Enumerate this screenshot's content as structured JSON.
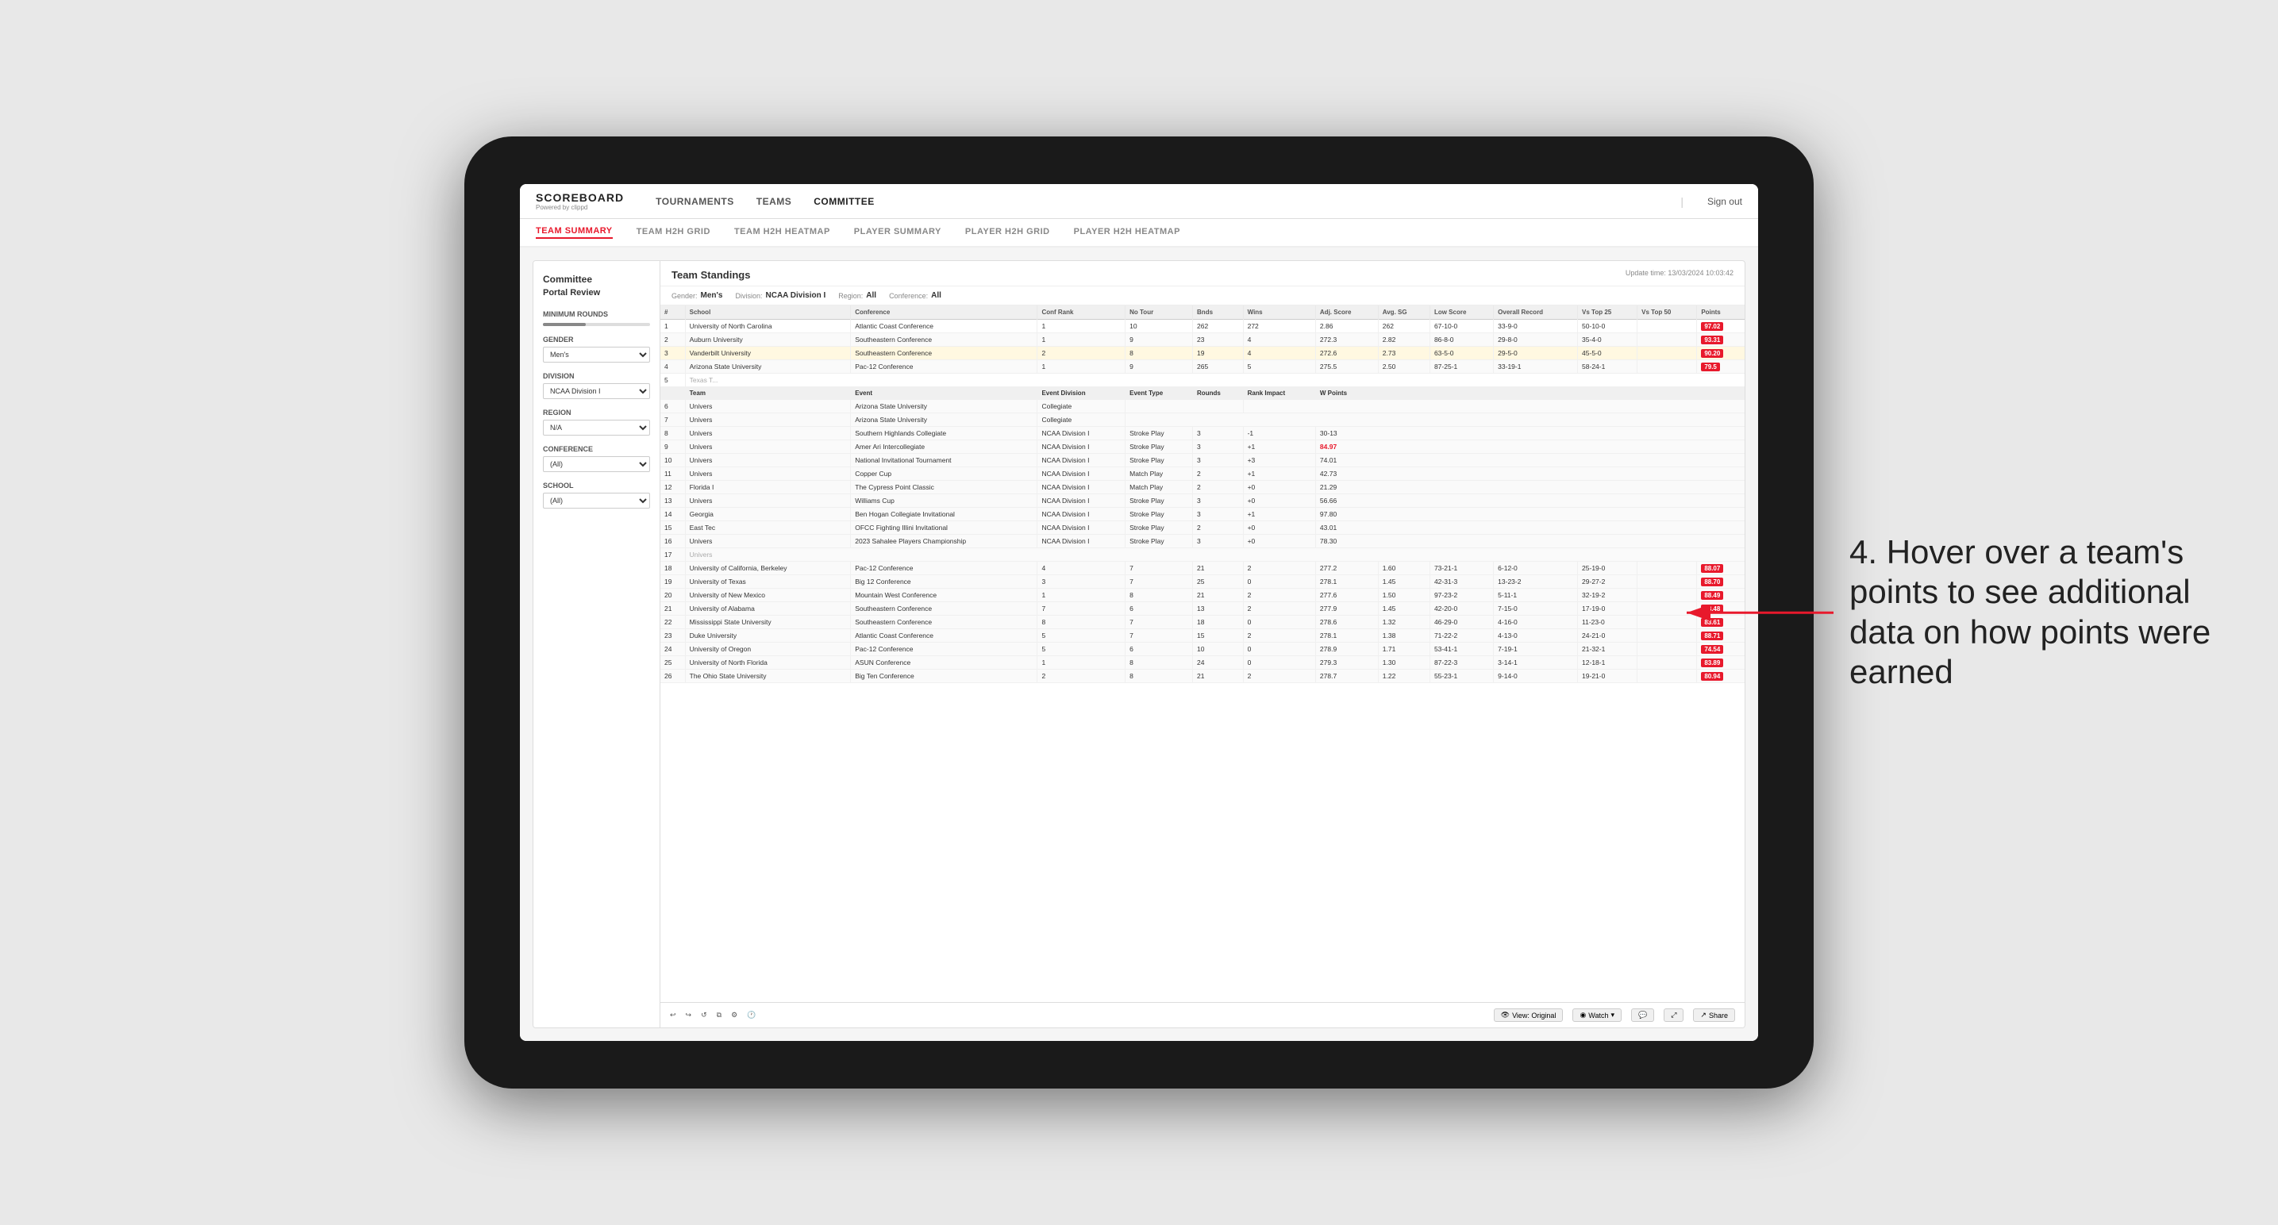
{
  "app": {
    "title": "SCOREBOARD",
    "subtitle": "Powered by clippd",
    "sign_out": "Sign out"
  },
  "nav": {
    "items": [
      {
        "label": "TOURNAMENTS",
        "active": false
      },
      {
        "label": "TEAMS",
        "active": false
      },
      {
        "label": "COMMITTEE",
        "active": true
      }
    ]
  },
  "secondary_nav": {
    "items": [
      {
        "label": "TEAM SUMMARY",
        "active": true
      },
      {
        "label": "TEAM H2H GRID",
        "active": false
      },
      {
        "label": "TEAM H2H HEATMAP",
        "active": false
      },
      {
        "label": "PLAYER SUMMARY",
        "active": false
      },
      {
        "label": "PLAYER H2H GRID",
        "active": false
      },
      {
        "label": "PLAYER H2H HEATMAP",
        "active": false
      }
    ]
  },
  "portal": {
    "sidebar_title": "Committee",
    "sidebar_subtitle": "Portal Review",
    "filters": {
      "min_rounds_label": "Minimum Rounds",
      "gender_label": "Gender",
      "gender_value": "Men's",
      "division_label": "Division",
      "division_value": "NCAA Division I",
      "region_label": "Region",
      "region_value": "N/A",
      "conference_label": "Conference",
      "conference_value": "(All)",
      "school_label": "School",
      "school_value": "(All)"
    },
    "main_title": "Team Standings",
    "update_time": "Update time: 13/03/2024 10:03:42",
    "filter_bar": {
      "gender_label": "Gender:",
      "gender_value": "Men's",
      "division_label": "Division:",
      "division_value": "NCAA Division I",
      "region_label": "Region:",
      "region_value": "All",
      "conference_label": "Conference:",
      "conference_value": "All"
    },
    "table_headers": [
      "#",
      "School",
      "Conference",
      "Conf Rank",
      "No Tour",
      "Bnds",
      "Wins",
      "Adj. Score",
      "Avg. SG",
      "Low Score",
      "Overall Record",
      "Vs Top 25",
      "Vs Top 50",
      "Points"
    ],
    "teams": [
      {
        "rank": 1,
        "school": "University of North Carolina",
        "conference": "Atlantic Coast Conference",
        "conf_rank": 1,
        "no_tour": 10,
        "bnds": 262,
        "wins": 272,
        "adj_score": 2.86,
        "avg_sg": 262,
        "low_score": "67-10-0",
        "overall_record": "33-9-0",
        "vs_top25": "50-10-0",
        "vs_top50": "",
        "points": "97.02",
        "highlighted": false
      },
      {
        "rank": 2,
        "school": "Auburn University",
        "conference": "Southeastern Conference",
        "conf_rank": 1,
        "no_tour": 9,
        "bnds": 23,
        "wins": 4,
        "adj_score": 272.3,
        "avg_sg": 2.82,
        "low_score": "86-8-0",
        "overall_record": "29-8-0",
        "vs_top25": "35-4-0",
        "vs_top50": "",
        "points": "93.31",
        "highlighted": false
      },
      {
        "rank": 3,
        "school": "Vanderbilt University",
        "conference": "Southeastern Conference",
        "conf_rank": 2,
        "no_tour": 8,
        "bnds": 19,
        "wins": 4,
        "adj_score": 272.6,
        "avg_sg": 2.73,
        "low_score": "63-5-0",
        "overall_record": "29-5-0",
        "vs_top25": "45-5-0",
        "vs_top50": "",
        "points": "90.20",
        "highlighted": true,
        "tooltip": true
      },
      {
        "rank": 4,
        "school": "Arizona State University",
        "conference": "Pac-12 Conference",
        "conf_rank": 1,
        "no_tour": 9,
        "bnds": 265,
        "wins": 5,
        "adj_score": 275.5,
        "avg_sg": 2.5,
        "low_score": "87-25-1",
        "overall_record": "33-19-1",
        "vs_top25": "58-24-1",
        "vs_top50": "",
        "points": "79.5",
        "highlighted": false
      },
      {
        "rank": 5,
        "school": "Texas T...",
        "conference": "",
        "conf_rank": "",
        "no_tour": "",
        "bnds": "",
        "wins": "",
        "adj_score": "",
        "avg_sg": "",
        "low_score": "",
        "overall_record": "",
        "vs_top25": "",
        "vs_top50": "",
        "points": "",
        "highlighted": false
      },
      {
        "rank": 6,
        "school": "Univers",
        "conference": "",
        "conf_rank": "",
        "no_tour": "",
        "bnds": "",
        "wins": "",
        "adj_score": "",
        "avg_sg": "",
        "low_score": "",
        "overall_record": "",
        "vs_top25": "",
        "vs_top50": "",
        "points": "",
        "tooltip_row": true
      },
      {
        "rank": 7,
        "school": "Univers",
        "conference": "Arizona State University",
        "conf_rank": "Collegiate",
        "no_tour": "",
        "bnds": "",
        "wins": "",
        "adj_score": "",
        "avg_sg": "",
        "low_score": "",
        "overall_record": "",
        "vs_top25": "",
        "vs_top50": "",
        "points": ""
      },
      {
        "rank": 8,
        "school": "Univers",
        "conference": "Southern Highlands Collegiate",
        "conf_rank": "NCAA Division I",
        "no_tour": "Stroke Play",
        "bnds": 3,
        "wins": -1,
        "adj_score": "",
        "avg_sg": "",
        "low_score": "",
        "overall_record": "",
        "vs_top25": "",
        "vs_top50": "",
        "points": "30-13"
      },
      {
        "rank": 9,
        "school": "Univers",
        "conference": "Amer Ari Intercollegiate",
        "conf_rank": "NCAA Division I",
        "no_tour": "Stroke Play",
        "bnds": 3,
        "wins": "+1",
        "adj_score": "",
        "avg_sg": "",
        "low_score": "",
        "overall_record": "",
        "vs_top25": "",
        "vs_top50": "",
        "points": "84.97"
      },
      {
        "rank": 10,
        "school": "Univers",
        "conference": "National Invitational Tournament",
        "conf_rank": "NCAA Division I",
        "no_tour": "Stroke Play",
        "bnds": 3,
        "wins": "+3",
        "adj_score": "",
        "avg_sg": "",
        "low_score": "",
        "overall_record": "",
        "vs_top25": "",
        "vs_top50": "",
        "points": "74.01"
      },
      {
        "rank": 11,
        "school": "Univers",
        "conference": "Copper Cup",
        "conf_rank": "NCAA Division I",
        "no_tour": "Match Play",
        "bnds": 2,
        "wins": "+1",
        "adj_score": "",
        "avg_sg": "",
        "low_score": "",
        "overall_record": "",
        "vs_top25": "",
        "vs_top50": "",
        "points": "42.73"
      },
      {
        "rank": 12,
        "school": "Florida I",
        "conference": "The Cypress Point Classic",
        "conf_rank": "NCAA Division I",
        "no_tour": "Match Play",
        "bnds": 2,
        "wins": "+0",
        "adj_score": "",
        "avg_sg": "",
        "low_score": "",
        "overall_record": "",
        "vs_top25": "",
        "vs_top50": "",
        "points": "21.29"
      },
      {
        "rank": 13,
        "school": "Univers",
        "conference": "Williams Cup",
        "conf_rank": "NCAA Division I",
        "no_tour": "Stroke Play",
        "bnds": 3,
        "wins": "+0",
        "adj_score": "",
        "avg_sg": "",
        "low_score": "",
        "overall_record": "",
        "vs_top25": "",
        "vs_top50": "",
        "points": "56.66"
      },
      {
        "rank": 14,
        "school": "Georgia",
        "conference": "Ben Hogan Collegiate Invitational",
        "conf_rank": "NCAA Division I",
        "no_tour": "Stroke Play",
        "bnds": 3,
        "wins": "+1",
        "adj_score": "",
        "avg_sg": "",
        "low_score": "",
        "overall_record": "",
        "vs_top25": "",
        "vs_top50": "",
        "points": "97.80"
      },
      {
        "rank": 15,
        "school": "East Tec",
        "conference": "OFCC Fighting Illini Invitational",
        "conf_rank": "NCAA Division I",
        "no_tour": "Stroke Play",
        "bnds": 2,
        "wins": "+0",
        "adj_score": "",
        "avg_sg": "",
        "low_score": "",
        "overall_record": "",
        "vs_top25": "",
        "vs_top50": "",
        "points": "43.01"
      },
      {
        "rank": 16,
        "school": "Univers",
        "conference": "2023 Sahalee Players Championship",
        "conf_rank": "NCAA Division I",
        "no_tour": "Stroke Play",
        "bnds": 3,
        "wins": "+0",
        "adj_score": "",
        "avg_sg": "",
        "low_score": "",
        "overall_record": "",
        "vs_top25": "",
        "vs_top50": "",
        "points": "78.30"
      },
      {
        "rank": 17,
        "school": "Univers",
        "conference": "",
        "conf_rank": "",
        "no_tour": "",
        "bnds": "",
        "wins": "",
        "adj_score": "",
        "avg_sg": "",
        "low_score": "",
        "overall_record": "",
        "vs_top25": "",
        "vs_top50": "",
        "points": ""
      },
      {
        "rank": 18,
        "school": "University of California, Berkeley",
        "conference": "Pac-12 Conference",
        "conf_rank": 4,
        "no_tour": 7,
        "bnds": 21,
        "wins": 2,
        "adj_score": 277.2,
        "avg_sg": 1.6,
        "low_score": "73-21-1",
        "overall_record": "6-12-0",
        "vs_top25": "25-19-0",
        "vs_top50": "",
        "points": "88.07"
      },
      {
        "rank": 19,
        "school": "University of Texas",
        "conference": "Big 12 Conference",
        "conf_rank": 3,
        "no_tour": 7,
        "bnds": 25,
        "wins": 0,
        "adj_score": 278.1,
        "avg_sg": 1.45,
        "low_score": "42-31-3",
        "overall_record": "13-23-2",
        "vs_top25": "29-27-2",
        "vs_top50": "",
        "points": "88.70"
      },
      {
        "rank": 20,
        "school": "University of New Mexico",
        "conference": "Mountain West Conference",
        "conf_rank": 1,
        "no_tour": 8,
        "bnds": 21,
        "wins": 2,
        "adj_score": 277.6,
        "avg_sg": 1.5,
        "low_score": "97-23-2",
        "overall_record": "5-11-1",
        "vs_top25": "32-19-2",
        "vs_top50": "",
        "points": "88.49"
      },
      {
        "rank": 21,
        "school": "University of Alabama",
        "conference": "Southeastern Conference",
        "conf_rank": 7,
        "no_tour": 6,
        "bnds": 13,
        "wins": 2,
        "adj_score": 277.9,
        "avg_sg": 1.45,
        "low_score": "42-20-0",
        "overall_record": "7-15-0",
        "vs_top25": "17-19-0",
        "vs_top50": "",
        "points": "88.48"
      },
      {
        "rank": 22,
        "school": "Mississippi State University",
        "conference": "Southeastern Conference",
        "conf_rank": 8,
        "no_tour": 7,
        "bnds": 18,
        "wins": 0,
        "adj_score": 278.6,
        "avg_sg": 1.32,
        "low_score": "46-29-0",
        "overall_record": "4-16-0",
        "vs_top25": "11-23-0",
        "vs_top50": "",
        "points": "83.61"
      },
      {
        "rank": 23,
        "school": "Duke University",
        "conference": "Atlantic Coast Conference",
        "conf_rank": 5,
        "no_tour": 7,
        "bnds": 15,
        "wins": 2,
        "adj_score": 278.1,
        "avg_sg": 1.38,
        "low_score": "71-22-2",
        "overall_record": "4-13-0",
        "vs_top25": "24-21-0",
        "vs_top50": "",
        "points": "88.71"
      },
      {
        "rank": 24,
        "school": "University of Oregon",
        "conference": "Pac-12 Conference",
        "conf_rank": 5,
        "no_tour": 6,
        "bnds": 10,
        "wins": 0,
        "adj_score": 278.9,
        "avg_sg": 1.71,
        "low_score": "53-41-1",
        "overall_record": "7-19-1",
        "vs_top25": "21-32-1",
        "vs_top50": "",
        "points": "74.54"
      },
      {
        "rank": 25,
        "school": "University of North Florida",
        "conference": "ASUN Conference",
        "conf_rank": 1,
        "no_tour": 8,
        "bnds": 24,
        "wins": 0,
        "adj_score": 279.3,
        "avg_sg": 1.3,
        "low_score": "87-22-3",
        "overall_record": "3-14-1",
        "vs_top25": "12-18-1",
        "vs_top50": "",
        "points": "83.89"
      },
      {
        "rank": 26,
        "school": "The Ohio State University",
        "conference": "Big Ten Conference",
        "conf_rank": 2,
        "no_tour": 8,
        "bnds": 21,
        "wins": 2,
        "adj_score": 278.7,
        "avg_sg": 1.22,
        "low_score": "55-23-1",
        "overall_record": "9-14-0",
        "vs_top25": "19-21-0",
        "vs_top50": "",
        "points": "80.94"
      }
    ],
    "tooltip_headers": [
      "Team",
      "Event",
      "Event Division",
      "Event Type",
      "Rounds",
      "Rank Impact",
      "W Points"
    ],
    "bottom_bar": {
      "undo": "↩",
      "redo": "↪",
      "reset": "↺",
      "view_label": "View: Original",
      "watch_label": "Watch",
      "share_label": "Share"
    }
  },
  "annotation": {
    "text": "4. Hover over a team's points to see additional data on how points were earned"
  }
}
